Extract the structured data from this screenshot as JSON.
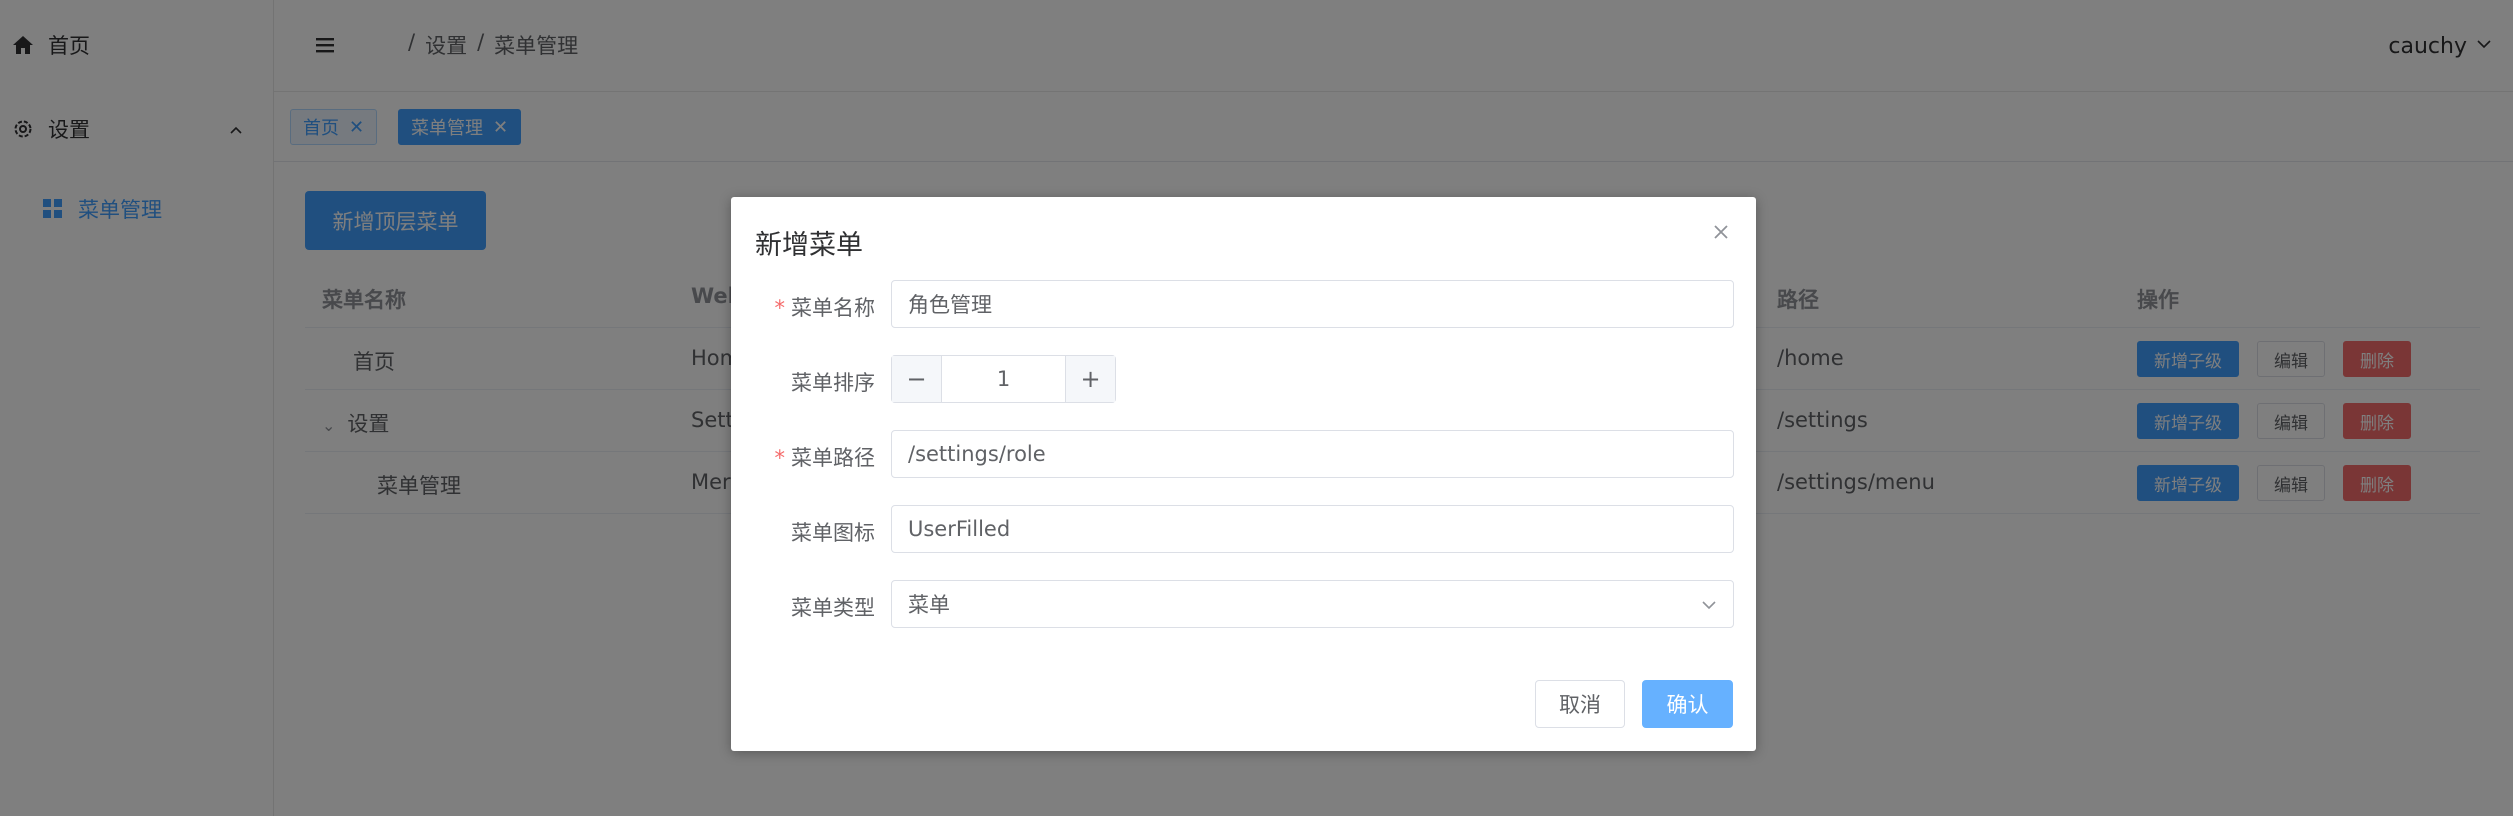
{
  "sidebar": {
    "home_label": "首页",
    "settings_label": "设置",
    "menu_mgmt_label": "菜单管理"
  },
  "header": {
    "breadcrumb": [
      "设置",
      "菜单管理"
    ],
    "breadcrumb_sep": "/",
    "username": "cauchy"
  },
  "tags": [
    {
      "label": "首页"
    },
    {
      "label": "菜单管理"
    }
  ],
  "main": {
    "add_top_button": "新增顶层菜单",
    "table": {
      "columns": [
        "菜单名称",
        "Web",
        "路径",
        "操作"
      ],
      "rows": [
        {
          "name": "首页",
          "web": "Hom",
          "path": "/home"
        },
        {
          "name": "设置",
          "web": "Sett",
          "path": "/settings"
        },
        {
          "name": "菜单管理",
          "web": "Mer",
          "path": "/settings/menu"
        }
      ],
      "op_add_child": "新增子级",
      "op_edit": "编辑",
      "op_delete": "删除"
    }
  },
  "dialog": {
    "title": "新增菜单",
    "fields": {
      "name_label": "菜单名称",
      "name_value": "角色管理",
      "order_label": "菜单排序",
      "order_value": "1",
      "path_label": "菜单路径",
      "path_value": "/settings/role",
      "icon_label": "菜单图标",
      "icon_value": "UserFilled",
      "type_label": "菜单类型",
      "type_value": "菜单"
    },
    "required_mark": "*",
    "cancel_label": "取消",
    "confirm_label": "确认"
  },
  "colors": {
    "primary": "#409eff",
    "danger": "#f56c6c",
    "overlay": "rgba(0,0,0,0.5)"
  }
}
